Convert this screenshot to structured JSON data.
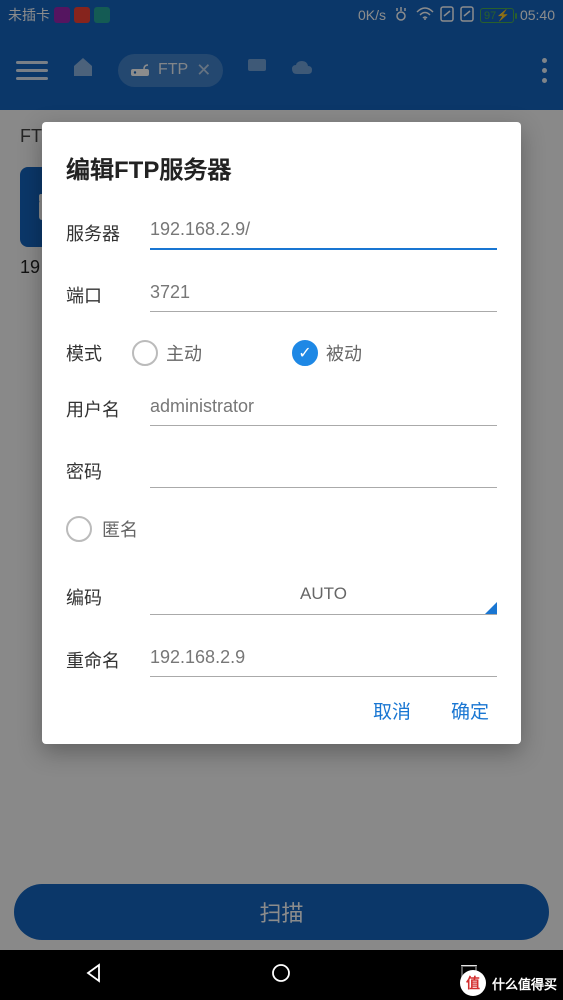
{
  "status": {
    "sim": "未插卡",
    "speed": "0K/s",
    "battery": "97",
    "time": "05:40"
  },
  "appbar": {
    "tab_label": "FTP"
  },
  "background": {
    "breadcrumb": "FT",
    "ip_short": "19"
  },
  "scan": {
    "label": "扫描"
  },
  "modal": {
    "title": "编辑FTP服务器",
    "fields": {
      "server_label": "服务器",
      "server_value": "192.168.2.9/",
      "port_label": "端口",
      "port_value": "3721",
      "mode_label": "模式",
      "mode_active": "主动",
      "mode_passive": "被动",
      "username_label": "用户名",
      "username_value": "administrator",
      "password_label": "密码",
      "password_value": "",
      "anonymous_label": "匿名",
      "encoding_label": "编码",
      "encoding_value": "AUTO",
      "rename_label": "重命名",
      "rename_value": "192.168.2.9"
    },
    "actions": {
      "cancel": "取消",
      "ok": "确定"
    }
  },
  "watermark": {
    "badge": "值",
    "text": "什么值得买"
  }
}
